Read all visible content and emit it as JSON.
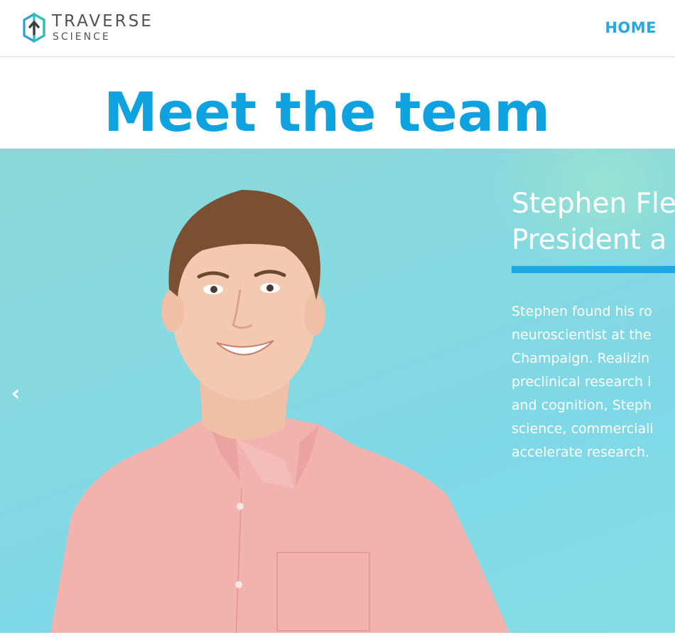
{
  "header": {
    "logo_word1": "TRAVERSE",
    "logo_word2": "SCIENCE",
    "nav_home": "HOME"
  },
  "main": {
    "title": "Meet the team"
  },
  "carousel": {
    "prev_label": "‹",
    "slide": {
      "name": "Stephen Fle",
      "role": "President a",
      "bio_lines": [
        "Stephen found his ro",
        "neuroscientist at the",
        "Champaign. Realizin",
        "preclinical research i",
        "and cognition, Steph",
        "science, commerciali",
        "accelerate research."
      ]
    }
  },
  "colors": {
    "brand_blue": "#0fa2e0",
    "nav_blue": "#29a7df",
    "accent_bar": "#1fa8e2",
    "logo_teal": "#2bbfb4",
    "logo_blue": "#2a9fd8"
  }
}
